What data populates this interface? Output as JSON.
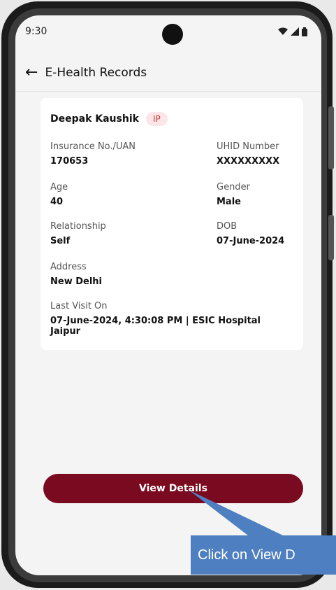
{
  "status_bar": {
    "time": "9:30"
  },
  "header": {
    "title": "E-Health Records"
  },
  "patient": {
    "name": "Deepak Kaushik",
    "badge": "IP",
    "fields": {
      "insurance_label": "Insurance No./UAN",
      "insurance_value": "170653",
      "uhid_label": "UHID Number",
      "uhid_value": "XXXXXXXXX",
      "age_label": "Age",
      "age_value": "40",
      "gender_label": "Gender",
      "gender_value": "Male",
      "relationship_label": "Relationship",
      "relationship_value": "Self",
      "dob_label": "DOB",
      "dob_value": "07-June-2024",
      "address_label": "Address",
      "address_value": "New Delhi",
      "last_visit_label": "Last Visit On",
      "last_visit_value": "07-June-2024, 4:30:08 PM | ESIC Hospital Jaipur"
    }
  },
  "actions": {
    "view_details": "View Details"
  },
  "callout": {
    "text": "Click on View D"
  },
  "colors": {
    "primary": "#7a0a1f",
    "callout": "#4e7fc0",
    "badge_bg": "#fde6ea"
  },
  "icons": [
    "back-arrow-icon",
    "wifi-icon",
    "signal-icon",
    "battery-icon"
  ]
}
